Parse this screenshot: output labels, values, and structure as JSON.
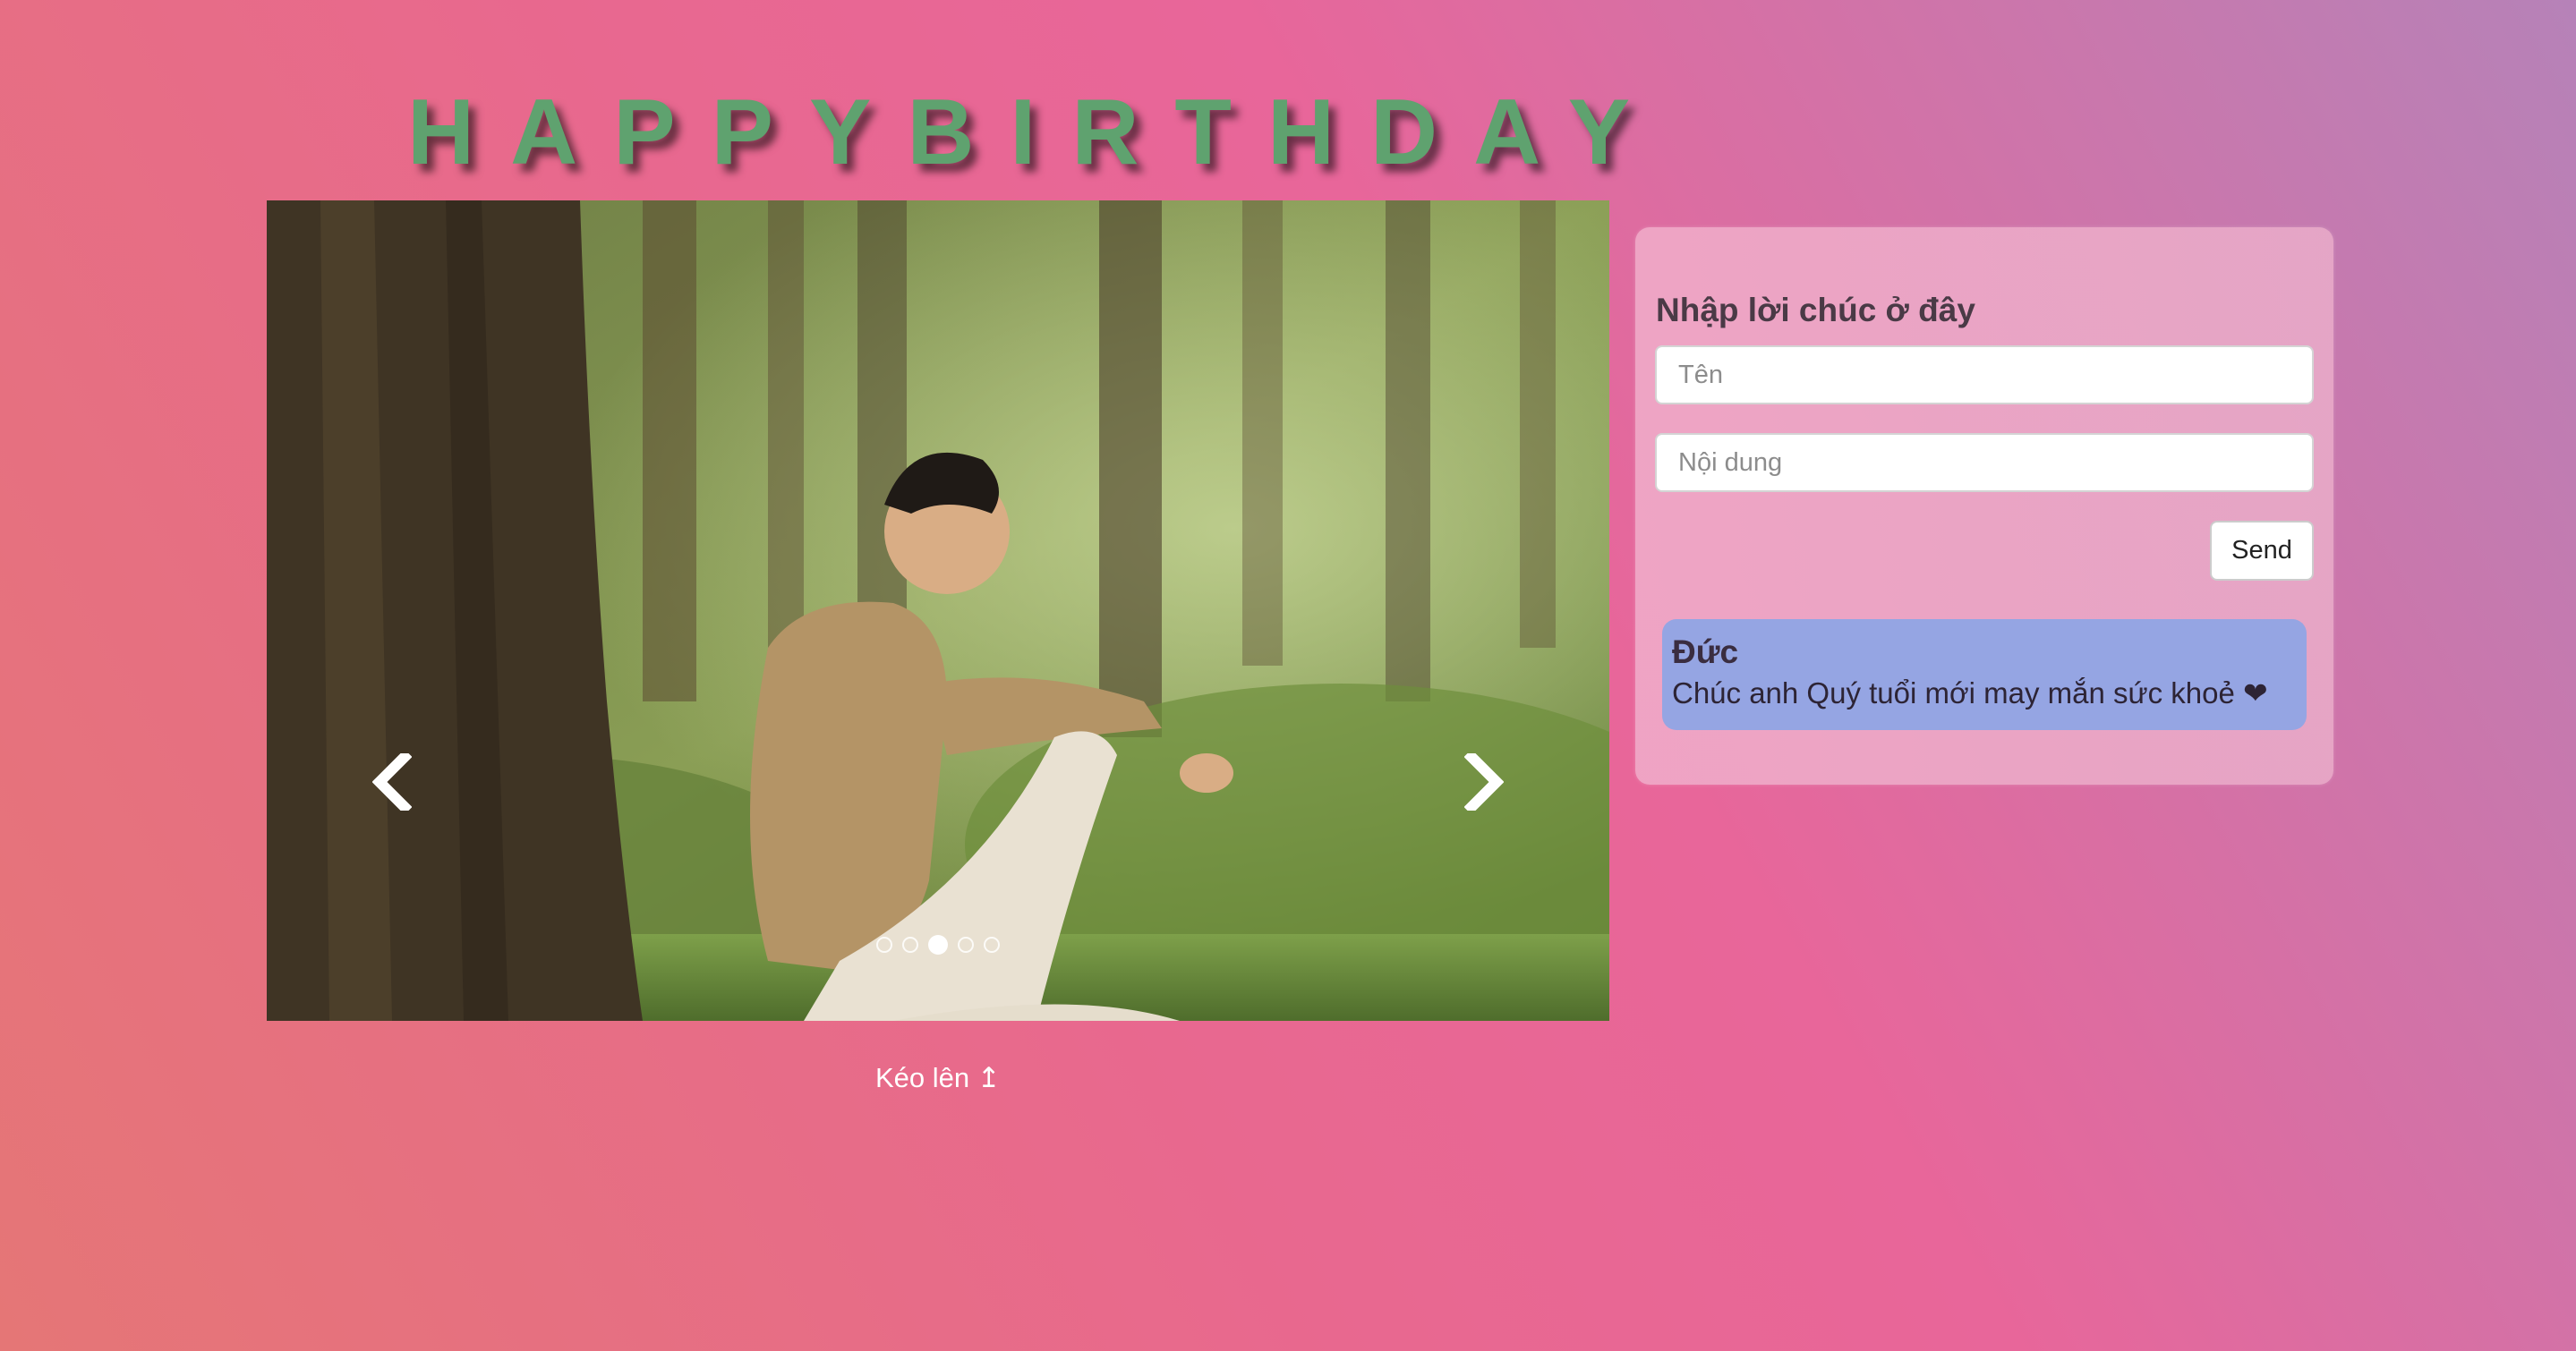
{
  "page": {
    "title": "HAPPYBIRTHDAY",
    "scroll_link": "Kéo lên ↥"
  },
  "carousel": {
    "prev_icon": "chevron-left-icon",
    "next_icon": "chevron-right-icon",
    "slide_count": 5,
    "active_slide": 3
  },
  "wish_form": {
    "heading": "Nhập lời chúc ở đây",
    "name_placeholder": "Tên",
    "content_placeholder": "Nội dung",
    "send_label": "Send"
  },
  "wishes": [
    {
      "name": "Đức",
      "message": "Chúc anh Quý tuổi mới may mắn sức khoẻ ❤"
    }
  ],
  "colors": {
    "title": "#5fa26f",
    "wish_card": "#95a5e3",
    "panel": "#eeaac6"
  }
}
